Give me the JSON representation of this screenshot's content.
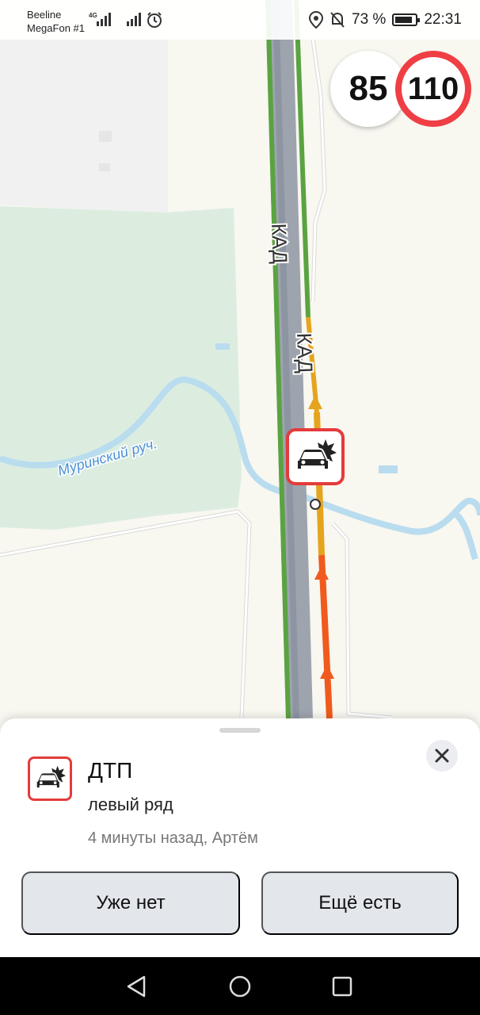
{
  "status_bar": {
    "carrier1": "Beeline",
    "carrier2": "MegaFon #1",
    "network": "4G",
    "battery_percent": "73 %",
    "time": "22:31",
    "icons": [
      "signal-icon",
      "alarm-icon",
      "location-icon",
      "mute-icon",
      "battery-icon"
    ]
  },
  "map": {
    "road_label_1": "КАД",
    "road_label_2": "КАД",
    "stream_label": "Муринский руч.",
    "current_speed": "85",
    "speed_limit": "110",
    "incident_icon": "car-crash-icon",
    "colors": {
      "traffic_free": "#5aa341",
      "traffic_medium": "#e5a41d",
      "traffic_heavy": "#f05a1c",
      "incident": "#e43b3b",
      "water": "#b9dcef",
      "park": "#dcede0"
    }
  },
  "incident_sheet": {
    "title": "ДТП",
    "detail": "левый ряд",
    "meta": "4 минуты назад, Артём",
    "dismiss_button": "Уже нет",
    "confirm_button": "Ещё есть"
  },
  "nav_bar": {
    "icons": [
      "back-icon",
      "home-icon",
      "recent-apps-icon"
    ]
  }
}
